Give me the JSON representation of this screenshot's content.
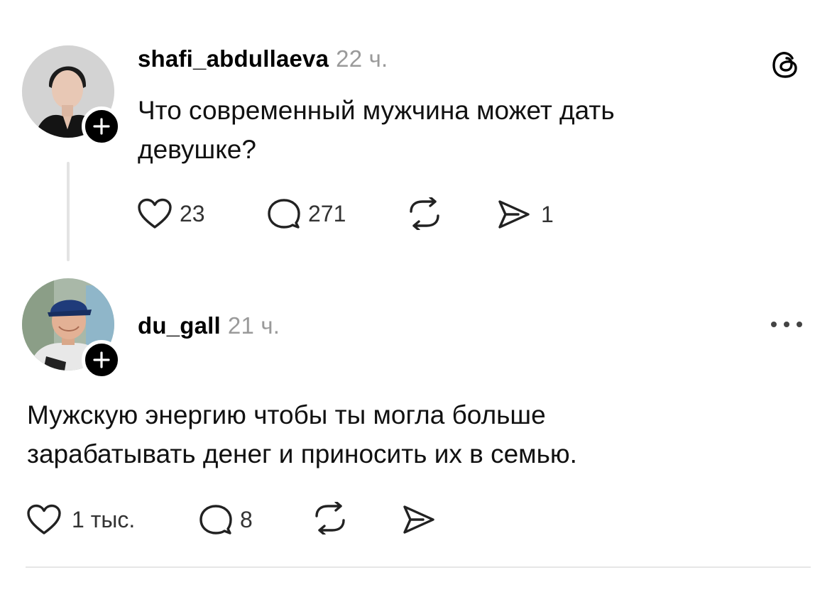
{
  "posts": [
    {
      "username": "shafi_abdullaeva",
      "time": "22 ч.",
      "text": "Что современный мужчина может дать девушке?",
      "likes": "23",
      "replies": "271",
      "shares": "1"
    },
    {
      "username": "du_gall",
      "time": "21 ч.",
      "text": "Мужскую энергию чтобы ты могла больше зарабатывать денег и приносить их в семью.",
      "likes": "1 тыс.",
      "replies": "8"
    }
  ],
  "icons": {
    "app_logo": "threads-logo-icon",
    "more": "more-options-icon",
    "like": "heart-icon",
    "reply": "comment-icon",
    "repost": "repost-icon",
    "share": "send-icon",
    "follow": "plus-icon"
  }
}
